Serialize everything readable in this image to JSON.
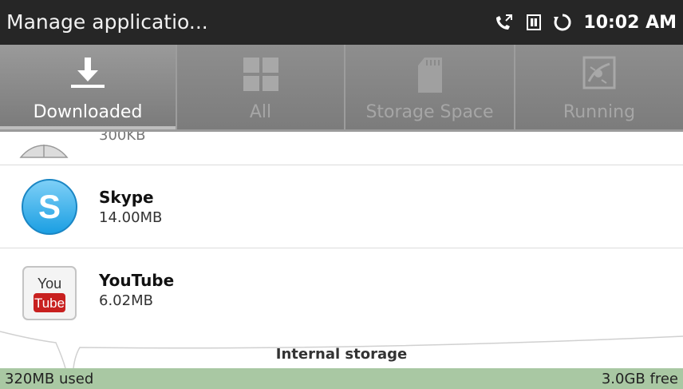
{
  "status_bar": {
    "title": "Manage applicatio...",
    "time": "10:02 AM",
    "icons": [
      "call-forward-icon",
      "sim-card-icon",
      "sync-icon"
    ]
  },
  "tabs": [
    {
      "label": "Downloaded",
      "icon": "download-icon",
      "selected": true
    },
    {
      "label": "All",
      "icon": "grid-icon",
      "selected": false
    },
    {
      "label": "Storage Space",
      "icon": "sd-card-icon",
      "selected": false
    },
    {
      "label": "Running",
      "icon": "running-app-icon",
      "selected": false
    }
  ],
  "apps": [
    {
      "name": "",
      "size": "300KB",
      "icon": "partial-app-icon"
    },
    {
      "name": "Skype",
      "size": "14.00MB",
      "icon": "skype-icon"
    },
    {
      "name": "YouTube",
      "size": "6.02MB",
      "icon": "youtube-icon"
    }
  ],
  "storage": {
    "label": "Internal storage",
    "used": "320MB used",
    "free": "3.0GB free",
    "used_fraction": 0.1
  },
  "colors": {
    "status_bar": "#262626",
    "tab_bar": "#8a8a8a",
    "storage_bar": "#a9c8a3"
  }
}
